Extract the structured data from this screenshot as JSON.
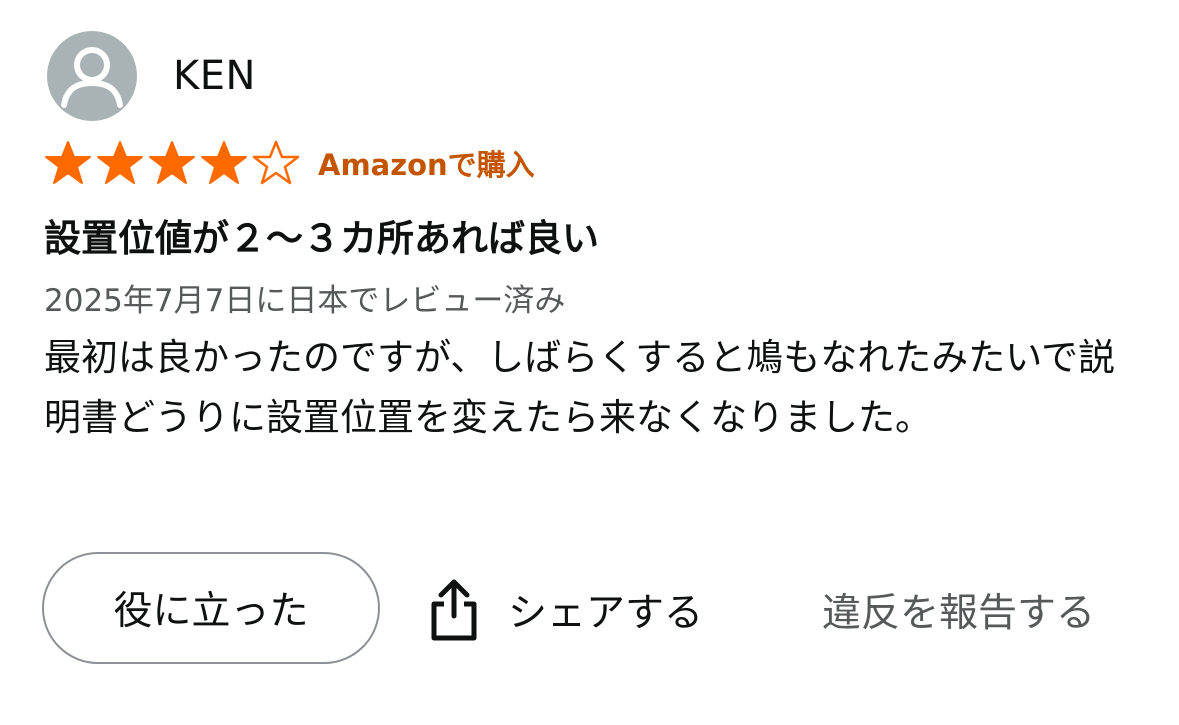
{
  "reviewer": {
    "name": "KEN",
    "avatar_icon": "default-user-avatar-icon"
  },
  "rating": {
    "value": 4,
    "max": 5,
    "star_color": "#ff6a00"
  },
  "verified_label": "Amazonで購入",
  "verified_color": "#c45500",
  "review": {
    "title": "設置位値が２～３カ所あれば良い",
    "date": "2025年7月7日に日本でレビュー済み",
    "body": "最初は良かったのですが、しばらくすると鳩もなれたみたいで説明書どうりに設置位置を変えたら来なくなりました。"
  },
  "actions": {
    "helpful_label": "役に立った",
    "share_label": "シェアする",
    "share_icon": "share-upload-icon",
    "report_label": "違反を報告する"
  }
}
